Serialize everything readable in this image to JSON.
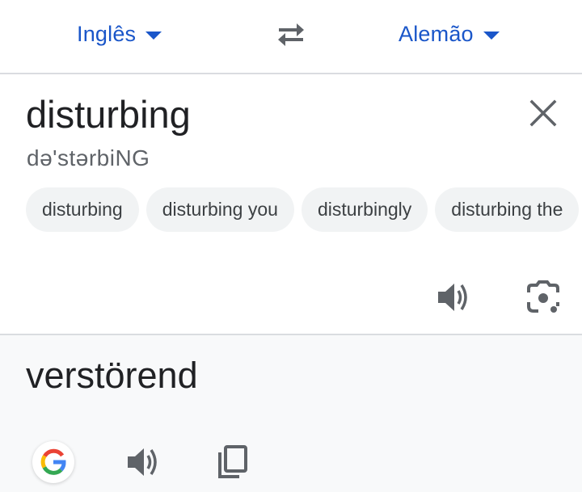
{
  "languages": {
    "source": "Inglês",
    "target": "Alemão"
  },
  "source": {
    "text": "disturbing",
    "phonetic": "də'stərbiNG",
    "suggestions": [
      "disturbing",
      "disturbing you",
      "disturbingly",
      "disturbing the"
    ]
  },
  "result": {
    "text": "verstörend"
  },
  "colors": {
    "accent": "#1a56c9",
    "icon": "#5f6368",
    "result_bg": "#f8f9fa",
    "divider": "#dadce0"
  },
  "icons": [
    "caret-down-icon",
    "swap-icon",
    "close-icon",
    "speaker-icon",
    "camera-lens-icon",
    "google-logo",
    "copy-icon"
  ]
}
